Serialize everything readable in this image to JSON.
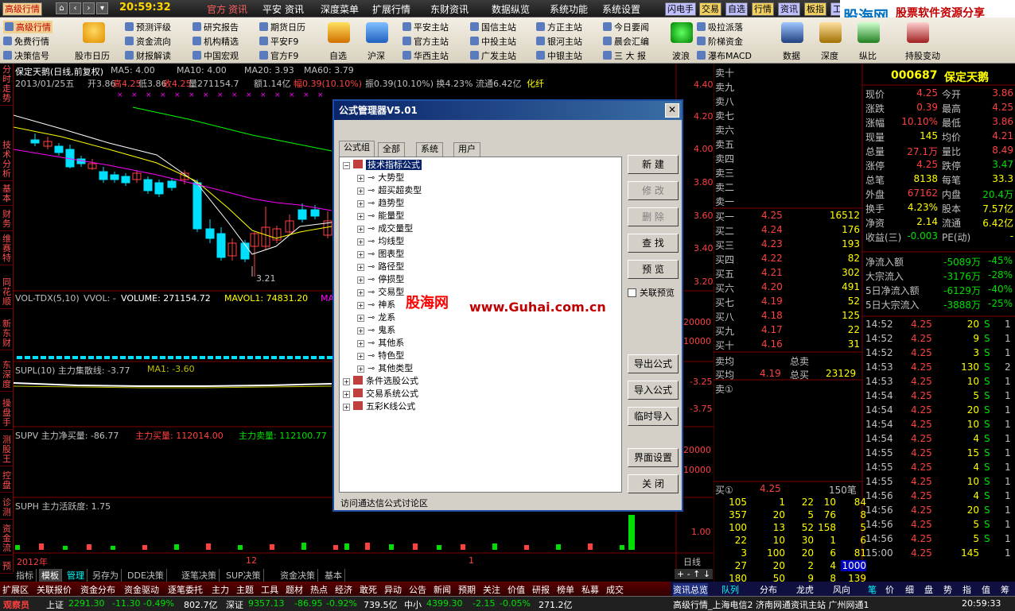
{
  "menubar": {
    "left_tab": "高级行情",
    "clock": "20:59:32",
    "items": [
      "官方",
      "资讯",
      "平安",
      "资讯",
      "深度菜单",
      "扩展行情",
      "东财资讯",
      "数据纵览",
      "系统功能",
      "系统设置"
    ],
    "right_tabs": [
      "闪电手",
      "交易",
      "自选",
      "行情",
      "资讯",
      "板指",
      "工"
    ],
    "brand_cn": "股海网",
    "brand_url": "www.Guhai.com.cn",
    "brand_tag": "股票软件资源分享"
  },
  "toolbar": {
    "col1": [
      "免费行情",
      "决策信号"
    ],
    "col1_top": "高级行情",
    "big1": "股市日历",
    "col2": [
      "预测评级",
      "资金流向",
      "财报解读"
    ],
    "col3": [
      "研究报告",
      "机构精选",
      "中国宏观"
    ],
    "col4": [
      "期货日历",
      "平安F9",
      "官方F9"
    ],
    "big2": "自选",
    "big3": "沪深",
    "col5": [
      "平安主站",
      "官方主站",
      "华西主站"
    ],
    "col6": [
      "国信主站",
      "中投主站",
      "广发主站"
    ],
    "col7": [
      "方正主站",
      "银河主站",
      "中银主站"
    ],
    "col8": [
      "今日要闻",
      "晨会汇编",
      "三 大 报"
    ],
    "big4": "波浪",
    "col9": [
      "吸拉派落",
      "阶梯资金",
      "瀑布MACD"
    ],
    "big5": "数据",
    "big6": "深度",
    "big7": "纵比",
    "big8": "持股变动"
  },
  "sidetabs": [
    "分时走势",
    "技术分析",
    "基本",
    "财务",
    "维赛特",
    "同花顺",
    "新东财",
    "东深度",
    "操盘手",
    "测股王",
    "控盘",
    "诊测",
    "资金流",
    "预"
  ],
  "chart": {
    "title": "保定天鹅(日线,前复权)",
    "ma": [
      {
        "label": "MA5: 4.00",
        "color": "#ffffff"
      },
      {
        "label": "MA10: 4.00",
        "color": "#ffff00"
      },
      {
        "label": "MA20: 3.93",
        "color": "#ff00ff"
      },
      {
        "label": "MA60: 3.79",
        "color": "#00ff00"
      }
    ],
    "info_date": "2013/01/25五",
    "info_open": "开3.86",
    "info_high": "高4.25",
    "info_low": "低3.86",
    "info_close": "收4.25",
    "info_vol": "量271154.7",
    "info_amt": "额1.14亿",
    "info_chg": "幅0.39(10.10%)",
    "info_rest": "振0.39(10.10%) 换4.23% 流通6.42亿",
    "info_tag": "化纤",
    "low_mark": "3.21",
    "price_axis": [
      "4.40",
      "4.20",
      "4.00",
      "3.80",
      "3.60",
      "3.40",
      "3.20"
    ],
    "vol_title": "VOL-TDX(5,10)",
    "vol_vvol": "VVOL: -",
    "vol_val": "VOLUME: 271154.72",
    "vol_mavol": "MAVOL1: 74831.20",
    "vol_tail": "MA",
    "vol_axis": [
      "20000",
      "10000"
    ],
    "supl_title": "SUPL(10) 主力集散线: -3.77",
    "supl_ma": "MA1: -3.60",
    "supl_axis": "-3.25",
    "supl_axis2": "-3.75",
    "supv_title": "SUPV 主力净买量: -86.77",
    "supv_buy": "主力买量: 112014.00",
    "supv_sell": "主力卖量: 112100.77",
    "supv_axis": "20000",
    "supv_axis2": "10000",
    "suph_title": "SUPH 主力活跃度: 1.75",
    "suph_axis": "1.00",
    "year_label": "2012年",
    "month_label": "12",
    "month2_label": "1",
    "day_line": "日线"
  },
  "dialog": {
    "title": "公式管理器V5.01",
    "tabs": [
      "公式组",
      "全部",
      "系统",
      "用户"
    ],
    "root": "技术指标公式",
    "items": [
      "大势型",
      "超买超卖型",
      "趋势型",
      "能量型",
      "成交量型",
      "均线型",
      "图表型",
      "路径型",
      "停损型",
      "交易型",
      "神系",
      "龙系",
      "鬼系",
      "其他系",
      "特色型",
      "其他类型"
    ],
    "groups": [
      "条件选股公式",
      "交易系统公式",
      "五彩K线公式"
    ],
    "buttons": {
      "new": "新 建",
      "edit": "修 改",
      "del": "删 除",
      "find": "查 找",
      "preview": "预 览",
      "link_preview": "关联预览",
      "export": "导出公式",
      "import": "导入公式",
      "temp_import": "临时导入",
      "ui_setting": "界面设置",
      "close": "关 闭"
    },
    "footer": "访问通达信公式讨论区",
    "watermark_cn": "股海网",
    "watermark_url": "www.Guhai.com.cn"
  },
  "order_book": {
    "sell": [
      {
        "label": "卖十"
      },
      {
        "label": "卖九"
      },
      {
        "label": "卖八"
      },
      {
        "label": "卖七"
      },
      {
        "label": "卖六"
      },
      {
        "label": "卖五"
      },
      {
        "label": "卖四"
      },
      {
        "label": "卖三"
      },
      {
        "label": "卖二"
      },
      {
        "label": "卖一"
      }
    ],
    "buy": [
      {
        "label": "买一",
        "price": "4.25",
        "vol": "16512"
      },
      {
        "label": "买二",
        "price": "4.24",
        "vol": "176"
      },
      {
        "label": "买三",
        "price": "4.23",
        "vol": "193"
      },
      {
        "label": "买四",
        "price": "4.22",
        "vol": "82"
      },
      {
        "label": "买五",
        "price": "4.21",
        "vol": "302"
      },
      {
        "label": "买六",
        "price": "4.20",
        "vol": "491"
      },
      {
        "label": "买七",
        "price": "4.19",
        "vol": "52"
      },
      {
        "label": "买八",
        "price": "4.18",
        "vol": "125"
      },
      {
        "label": "买九",
        "price": "4.17",
        "vol": "22"
      },
      {
        "label": "买十",
        "price": "4.16",
        "vol": "31"
      }
    ],
    "sell_avg": "卖均",
    "buy_avg": "买均",
    "buy_avg_price": "4.19",
    "total_sell": "总卖",
    "total_buy": "总买",
    "total_buy_val": "23129",
    "sell_q": "卖①",
    "buy_q": "买①",
    "buy_q_price": "4.25",
    "buy_q_count": "150笔",
    "queue": [
      [
        "105",
        "1",
        "22",
        "10",
        "84"
      ],
      [
        "357",
        "20",
        "5",
        "76",
        "8"
      ],
      [
        "100",
        "13",
        "52",
        "158",
        "5"
      ],
      [
        "22",
        "10",
        "30",
        "1",
        "6"
      ],
      [
        "3",
        "100",
        "20",
        "6",
        "81"
      ],
      [
        "27",
        "20",
        "2",
        "4",
        "1000"
      ],
      [
        "180",
        "50",
        "9",
        "8",
        "139"
      ]
    ]
  },
  "quote": {
    "code": "000687",
    "name": "保定天鹅",
    "rows": [
      [
        "现价",
        "4.25",
        "今开",
        "3.86"
      ],
      [
        "涨跌",
        "0.39",
        "最高",
        "4.25"
      ],
      [
        "涨幅",
        "10.10%",
        "最低",
        "3.86"
      ],
      [
        "现量",
        "145",
        "均价",
        "4.21"
      ],
      [
        "总量",
        "27.1万",
        "量比",
        "8.49"
      ],
      [
        "涨停",
        "4.25",
        "跌停",
        "3.47"
      ],
      [
        "总笔",
        "8138",
        "每笔",
        "33.3"
      ],
      [
        "外盘",
        "67162",
        "内盘",
        "20.4万"
      ],
      [
        "换手",
        "4.23%",
        "股本",
        "7.57亿"
      ],
      [
        "净资",
        "2.14",
        "流通",
        "6.42亿"
      ],
      [
        "收益(三)",
        "-0.003",
        "PE(动)",
        "-"
      ]
    ],
    "flows": [
      [
        "净流入额",
        "-5089万",
        "-45%"
      ],
      [
        "大宗流入",
        "-3176万",
        "-28%"
      ],
      [
        "5日净流入额",
        "-6129万",
        "-40%"
      ],
      [
        "5日大宗流入",
        "-3888万",
        "-25%"
      ]
    ]
  },
  "ticks": [
    [
      "14:52",
      "4.25",
      "20",
      "S",
      "1"
    ],
    [
      "14:52",
      "4.25",
      "9",
      "S",
      "1"
    ],
    [
      "14:52",
      "4.25",
      "3",
      "S",
      "1"
    ],
    [
      "14:53",
      "4.25",
      "130",
      "S",
      "2"
    ],
    [
      "14:53",
      "4.25",
      "10",
      "S",
      "1"
    ],
    [
      "14:54",
      "4.25",
      "5",
      "S",
      "1"
    ],
    [
      "14:54",
      "4.25",
      "20",
      "S",
      "1"
    ],
    [
      "14:54",
      "4.25",
      "10",
      "S",
      "1"
    ],
    [
      "14:54",
      "4.25",
      "4",
      "S",
      "1"
    ],
    [
      "14:55",
      "4.25",
      "15",
      "S",
      "1"
    ],
    [
      "14:55",
      "4.25",
      "4",
      "S",
      "1"
    ],
    [
      "14:55",
      "4.25",
      "10",
      "S",
      "1"
    ],
    [
      "14:56",
      "4.25",
      "4",
      "S",
      "1"
    ],
    [
      "14:56",
      "4.25",
      "20",
      "S",
      "1"
    ],
    [
      "14:56",
      "4.25",
      "5",
      "S",
      "1"
    ],
    [
      "14:56",
      "4.25",
      "5",
      "S",
      "1"
    ],
    [
      "15:00",
      "4.25",
      "145",
      "",
      "1"
    ]
  ],
  "bottom_tabs": [
    "指标",
    "模板",
    "管理",
    "另存为",
    "DDE决策",
    "逐笔决策",
    "SUP决策",
    "资金决策",
    "基本"
  ],
  "bottom_menu": [
    "扩展区",
    "关联报价",
    "资金分布",
    "资金驱动",
    "逐笔委托",
    "主力",
    "主题",
    "工具",
    "题材",
    "热点",
    "经济",
    "敢死",
    "异动",
    "公告",
    "新闻",
    "预期",
    "关注",
    "价值",
    "研报",
    "榜单",
    "私募",
    "成交"
  ],
  "right_bottom_tabs": [
    "资讯总览",
    "队列",
    "分布",
    "龙虎",
    "风向",
    "笔",
    "价",
    "细",
    "盘",
    "势",
    "指",
    "值",
    "筹"
  ],
  "status": {
    "user": "观察员",
    "sh_label": "上证",
    "sh_val": "2291.30",
    "sh_chg": "-11.30",
    "sh_pct": "-0.49%",
    "sh_amt": "802.7亿",
    "sz_label": "深证",
    "sz_val": "9357.13",
    "sz_chg": "-86.95",
    "sz_pct": "-0.92%",
    "sz_amt": "739.5亿",
    "zx_label": "中小",
    "zx_val": "4399.30",
    "zx_chg": "-2.15",
    "zx_pct": "-0.05%",
    "zx_amt": "271.2亿",
    "server": "高级行情_上海电信2 济南网通资讯主站 广州网通1",
    "time": "20:59:33"
  },
  "colors": {
    "up": "#ff4040",
    "down": "#00e000",
    "accent": "#ffff00",
    "panel_border": "#800000"
  }
}
